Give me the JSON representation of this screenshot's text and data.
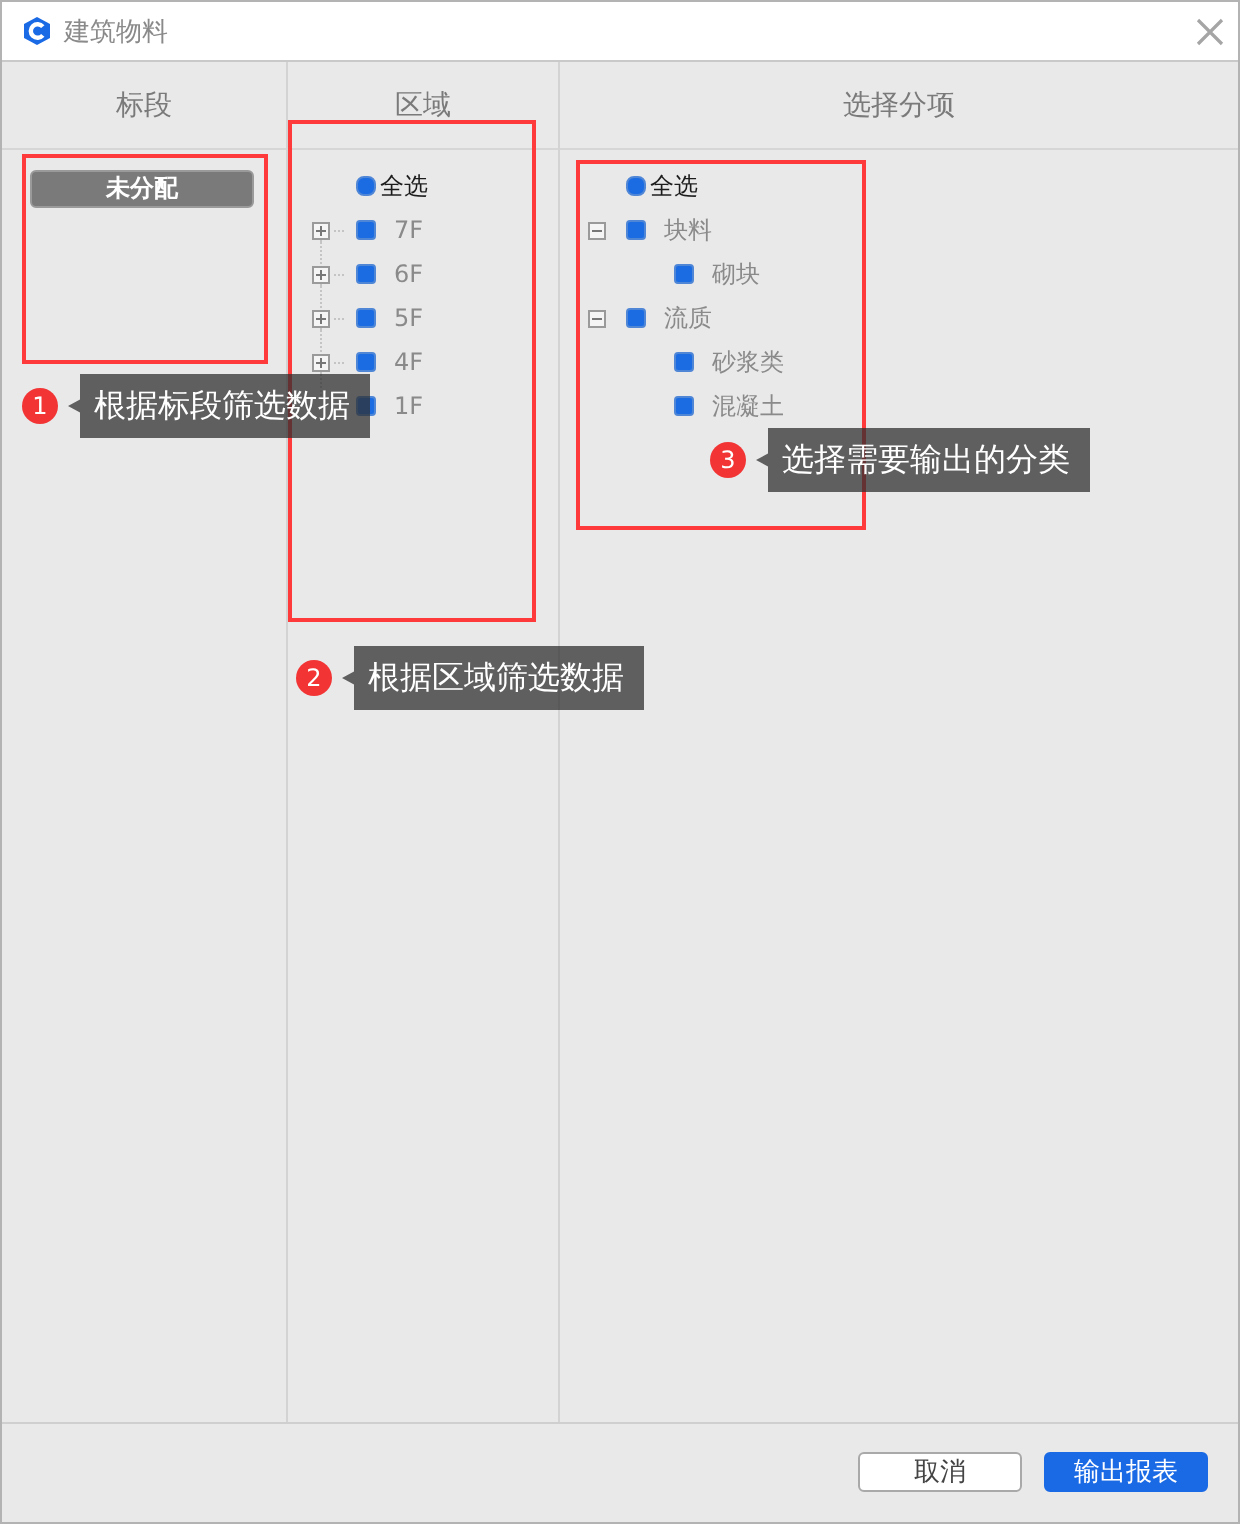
{
  "window": {
    "title": "建筑物料"
  },
  "segment_panel": {
    "header": "标段",
    "items": [
      {
        "label": "未分配",
        "selected": true
      }
    ]
  },
  "area_panel": {
    "header": "区域",
    "select_all": {
      "label": "全选",
      "checked": true
    },
    "items": [
      {
        "label": "7F",
        "checked": true,
        "expanded": false
      },
      {
        "label": "6F",
        "checked": true,
        "expanded": false
      },
      {
        "label": "5F",
        "checked": true,
        "expanded": false
      },
      {
        "label": "4F",
        "checked": true,
        "expanded": false
      },
      {
        "label": "1F",
        "checked": true
      }
    ]
  },
  "category_panel": {
    "header": "选择分项",
    "select_all": {
      "label": "全选",
      "checked": true
    },
    "items": [
      {
        "label": "块料",
        "checked": true,
        "expanded": true,
        "children": [
          {
            "label": "砌块",
            "checked": true
          }
        ]
      },
      {
        "label": "流质",
        "checked": true,
        "expanded": true,
        "children": [
          {
            "label": "砂浆类",
            "checked": true
          },
          {
            "label": "混凝土",
            "checked": true
          }
        ]
      }
    ]
  },
  "annotations": [
    {
      "number": "1",
      "text": "根据标段筛选数据"
    },
    {
      "number": "2",
      "text": "根据区域筛选数据"
    },
    {
      "number": "3",
      "text": "选择需要输出的分类"
    }
  ],
  "footer": {
    "buttons": [
      {
        "label": "取消",
        "kind": "secondary"
      },
      {
        "label": "输出报表",
        "kind": "primary"
      }
    ]
  }
}
